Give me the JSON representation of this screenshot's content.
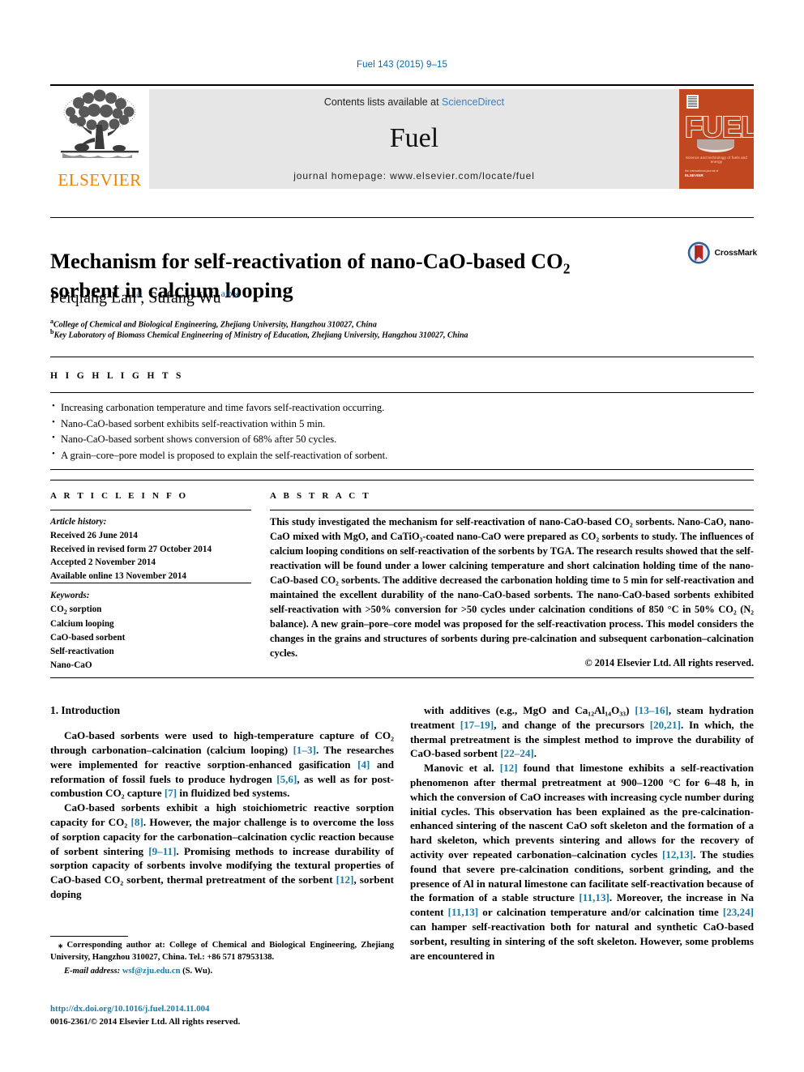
{
  "running_head": "Fuel 143 (2015) 9–15",
  "masthead": {
    "publisher_name": "ELSEVIER",
    "contents_prefix": "Contents lists available at ",
    "sciencedirect_link": "ScienceDirect",
    "journal_name": "Fuel",
    "homepage_line": "journal homepage: www.elsevier.com/locate/fuel",
    "cover": {
      "title": "FUEL",
      "subtitle": "Science and technology of fuels and energy",
      "footer_small": "the international journal of",
      "footer_brand": "ELSEVIER"
    },
    "link_color": "#3a7fc1",
    "brand_orange": "#ef8200",
    "cover_orange": "#c0471f"
  },
  "article": {
    "title_part1": "Mechanism for self-reactivation of nano-CaO-based CO",
    "title_sub": "2",
    "title_part2": " sorbent in calcium looping",
    "crossmark_label": "CrossMark",
    "authors": [
      {
        "name": "Peiqiang Lan",
        "marks": "a"
      },
      {
        "name": "Sufang Wu",
        "marks": "a,b,⁎"
      }
    ],
    "author_separator": ", ",
    "affiliations": [
      {
        "mark": "a",
        "text": "College of Chemical and Biological Engineering, Zhejiang University, Hangzhou 310027, China"
      },
      {
        "mark": "b",
        "text": "Key Laboratory of Biomass Chemical Engineering of Ministry of Education, Zhejiang University, Hangzhou 310027, China"
      }
    ]
  },
  "highlights": {
    "heading": "H I G H L I G H T S",
    "items": [
      "Increasing carbonation temperature and time favors self-reactivation occurring.",
      "Nano-CaO-based sorbent exhibits self-reactivation within 5 min.",
      "Nano-CaO-based sorbent shows conversion of 68% after 50 cycles.",
      "A grain–core–pore model is proposed to explain the self-reactivation of sorbent."
    ]
  },
  "article_info": {
    "heading": "A R T I C L E  I N F O",
    "history_label": "Article history:",
    "history": [
      "Received 26 June 2014",
      "Received in revised form 27 October 2014",
      "Accepted 2 November 2014",
      "Available online 13 November 2014"
    ],
    "keywords_label": "Keywords:",
    "keywords": [
      {
        "pre": "CO",
        "sub": "2",
        "post": " sorption"
      },
      {
        "pre": "Calcium looping",
        "sub": "",
        "post": ""
      },
      {
        "pre": "CaO-based sorbent",
        "sub": "",
        "post": ""
      },
      {
        "pre": "Self-reactivation",
        "sub": "",
        "post": ""
      },
      {
        "pre": "Nano-CaO",
        "sub": "",
        "post": ""
      }
    ]
  },
  "abstract": {
    "heading": "A B S T R A C T",
    "paragraphs": [
      "This study investigated the mechanism for self-reactivation of nano-CaO-based CO₂ sorbents. Nano-CaO, nano-CaO mixed with MgO, and CaTiO₃-coated nano-CaO were prepared as CO₂ sorbents to study. The influences of calcium looping conditions on self-reactivation of the sorbents by TGA. The research results showed that the self-reactivation will be found under a lower calcining temperature and short calcination holding time of the nano-CaO-based CO₂ sorbents. The additive decreased the carbonation holding time to 5 min for self-reactivation and maintained the excellent durability of the nano-CaO-based sorbents. The nano-CaO-based sorbents exhibited self-reactivation with >50% conversion for >50 cycles under calcination conditions of 850 °C in 50% CO₂ (N₂ balance). A new grain–pore–core model was proposed for the self-reactivation process. This model considers the changes in the grains and structures of sorbents during pre-calcination and subsequent carbonation–calcination cycles."
    ],
    "copyright": "© 2014 Elsevier Ltd. All rights reserved."
  },
  "body": {
    "section_heading": "1. Introduction",
    "left_paragraphs": [
      "CaO-based sorbents were used to high-temperature capture of CO₂ through carbonation–calcination (calcium looping) [1–3]. The researches were implemented for reactive sorption-enhanced gasification [4] and reformation of fossil fuels to produce hydrogen [5,6], as well as for post-combustion CO₂ capture [7] in fluidized bed systems.",
      "CaO-based sorbents exhibit a high stoichiometric reactive sorption capacity for CO₂ [8]. However, the major challenge is to overcome the loss of sorption capacity for the carbonation–calcination cyclic reaction because of sorbent sintering [9–11]. Promising methods to increase durability of sorption capacity of sorbents involve modifying the textural properties of CaO-based CO₂ sorbent, thermal pretreatment of the sorbent [12], sorbent doping"
    ],
    "right_paragraphs": [
      "with additives (e.g., MgO and Ca₁₂Al₁₄O₃₃) [13–16], steam hydration treatment [17–19], and change of the precursors [20,21]. In which, the thermal pretreatment is the simplest method to improve the durability of CaO-based sorbent [22–24].",
      "Manovic et al. [12] found that limestone exhibits a self-reactivation phenomenon after thermal pretreatment at 900–1200 °C for 6–48 h, in which the conversion of CaO increases with increasing cycle number during initial cycles. This observation has been explained as the pre-calcination-enhanced sintering of the nascent CaO soft skeleton and the formation of a hard skeleton, which prevents sintering and allows for the recovery of activity over repeated carbonation–calcination cycles [12,13]. The studies found that severe pre-calcination conditions, sorbent grinding, and the presence of Al in natural limestone can facilitate self-reactivation because of the formation of a stable structure [11,13]. Moreover, the increase in Na content [11,13] or calcination temperature and/or calcination time [23,24] can hamper self-reactivation both for natural and synthetic CaO-based sorbent, resulting in sintering of the soft skeleton. However, some problems are encountered in"
    ],
    "citation_color": "#1a7ba8"
  },
  "footnotes": {
    "corresponding": "⁎ Corresponding author at: College of Chemical and Biological Engineering, Zhejiang University, Hangzhou 310027, China. Tel.: +86 571 87953138.",
    "email_label": "E-mail address:",
    "email": "wsf@zju.edu.cn",
    "email_suffix": " (S. Wu).",
    "doi": "http://dx.doi.org/10.1016/j.fuel.2014.11.004",
    "issn_copyright": "0016-2361/© 2014 Elsevier Ltd. All rights reserved."
  }
}
